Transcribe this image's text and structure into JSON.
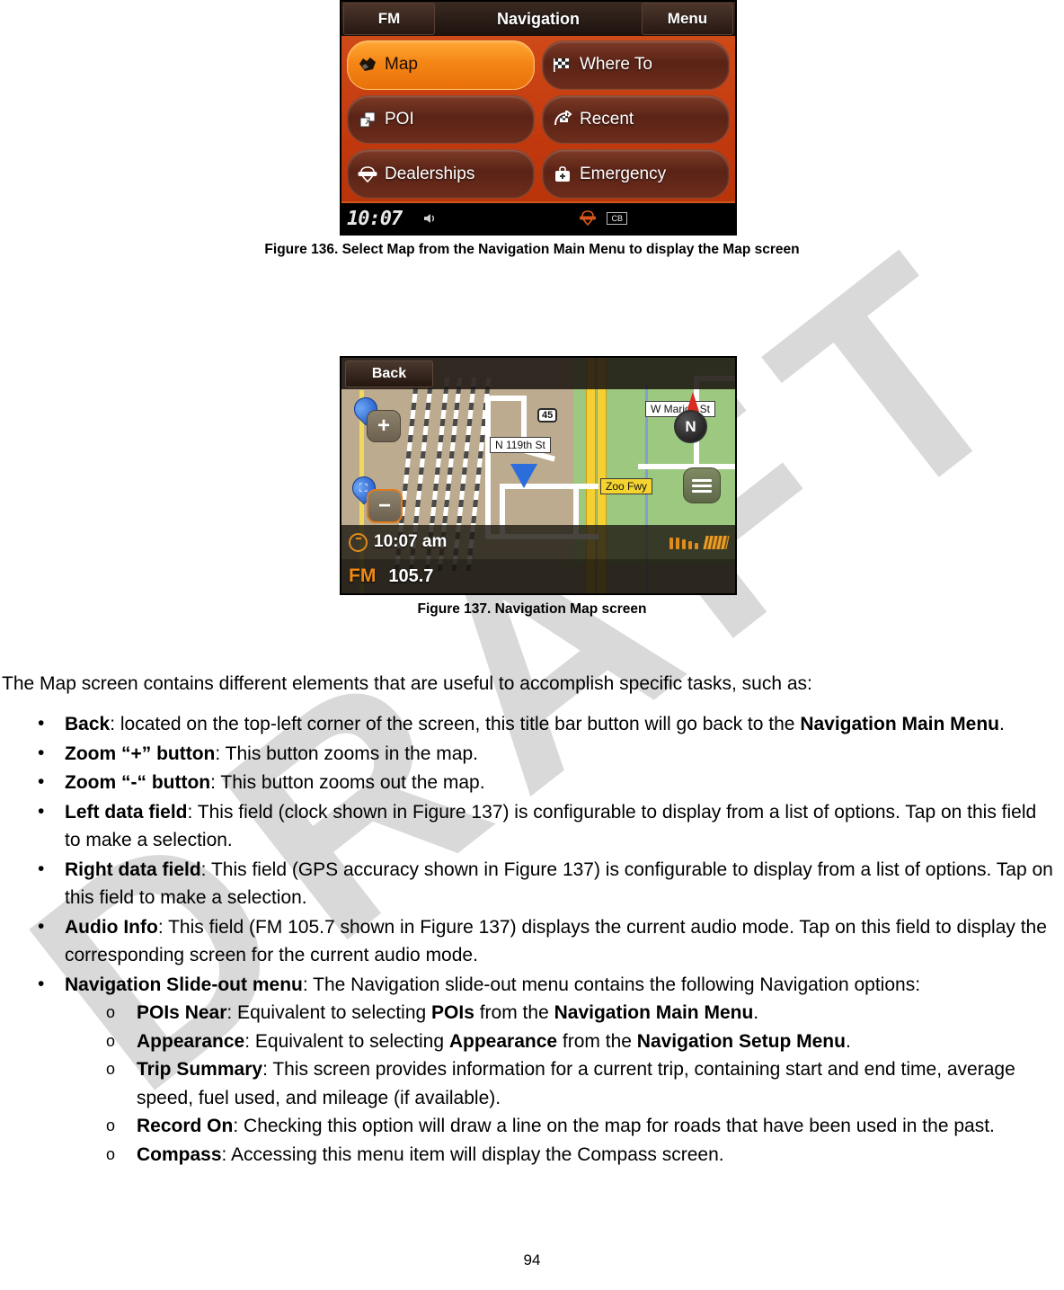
{
  "document": {
    "page_number": "94",
    "watermark": "DRAFT"
  },
  "figure136": {
    "caption": "Figure 136. Select Map from the Navigation Main Menu to display the Map screen",
    "title_bar": {
      "left_button": "FM",
      "title": "Navigation",
      "right_button": "Menu"
    },
    "buttons": [
      {
        "label": "Map",
        "icon": "globe-icon",
        "selected": true
      },
      {
        "label": "Where To",
        "icon": "checkered-flag-icon",
        "selected": false
      },
      {
        "label": "POI",
        "icon": "poi-cards-icon",
        "selected": false
      },
      {
        "label": "Recent",
        "icon": "recent-flag-icon",
        "selected": false
      },
      {
        "label": "Dealerships",
        "icon": "harley-bar-shield-icon",
        "selected": false
      },
      {
        "label": "Emergency",
        "icon": "emergency-kit-icon",
        "selected": false
      }
    ],
    "status_bar": {
      "clock": "10:07",
      "speaker_icon": "speaker-icon",
      "brand_icon": "harley-bar-shield-icon",
      "cb_label": "CB"
    }
  },
  "figure137": {
    "caption": "Figure 137. Navigation Map screen",
    "back_button": "Back",
    "zoom_in": "+",
    "zoom_out": "−",
    "compass_label": "N",
    "map_labels": {
      "street_1": "N 119th St",
      "street_2": "W Marion St",
      "freeway": "Zoo Fwy",
      "route_shield": "45"
    },
    "left_data_field": "10:07 am",
    "right_data_field_icon": "gps-signal-icon",
    "audio_info": {
      "source": "FM",
      "frequency": "105.7"
    }
  },
  "body": {
    "intro": "The Map screen contains different elements that are useful to accomplish specific tasks, such as:",
    "bullets": [
      {
        "term": "Back",
        "text_1": ": located on the top-left corner of the screen, this title bar button will go back to the ",
        "term_2": "Navigation Main Menu",
        "text_2": "."
      },
      {
        "term": "Zoom “+” button",
        "text_1": ": This button zooms in the map.",
        "term_2": "",
        "text_2": ""
      },
      {
        "term": "Zoom “-“ button",
        "text_1": ":  This button zooms out the map.",
        "term_2": "",
        "text_2": ""
      },
      {
        "term": "Left data field",
        "text_1": ": This field (clock shown in Figure 137) is configurable to display from a list of options. Tap on this field to make a selection.",
        "term_2": "",
        "text_2": ""
      },
      {
        "term": "Right data field",
        "text_1": ": This field (GPS accuracy shown in Figure 137) is configurable to display from a list of options. Tap on this field to make a selection.",
        "term_2": "",
        "text_2": ""
      },
      {
        "term": "Audio Info",
        "text_1": ": This field (FM 105.7 shown in Figure 137) displays the current audio mode. Tap on this field to display the corresponding screen for the current audio mode.",
        "term_2": "",
        "text_2": ""
      },
      {
        "term": "Navigation Slide-out menu",
        "text_1": ": The Navigation slide-out menu contains the following Navigation options:",
        "term_2": "",
        "text_2": ""
      }
    ],
    "subbullets": [
      {
        "term": "POIs Near",
        "text_1": ": Equivalent to selecting ",
        "term_2": "POIs",
        "text_2": " from the ",
        "term_3": "Navigation Main Menu",
        "text_3": "."
      },
      {
        "term": "Appearance",
        "text_1": ": Equivalent to selecting ",
        "term_2": "Appearance",
        "text_2": " from the ",
        "term_3": "Navigation Setup Menu",
        "text_3": "."
      },
      {
        "term": "Trip Summary",
        "text_1": ": This screen provides information for a current trip, containing start and end time, average speed, fuel used, and mileage (if available).",
        "term_2": "",
        "text_2": "",
        "term_3": "",
        "text_3": ""
      },
      {
        "term": "Record On",
        "text_1": ": Checking this option will draw a line on the map for roads that have been used in the past.",
        "term_2": "",
        "text_2": "",
        "term_3": "",
        "text_3": ""
      },
      {
        "term": "Compass",
        "text_1": ": Accessing this menu item will display the Compass screen.",
        "term_2": "",
        "text_2": "",
        "term_3": "",
        "text_3": ""
      }
    ]
  }
}
